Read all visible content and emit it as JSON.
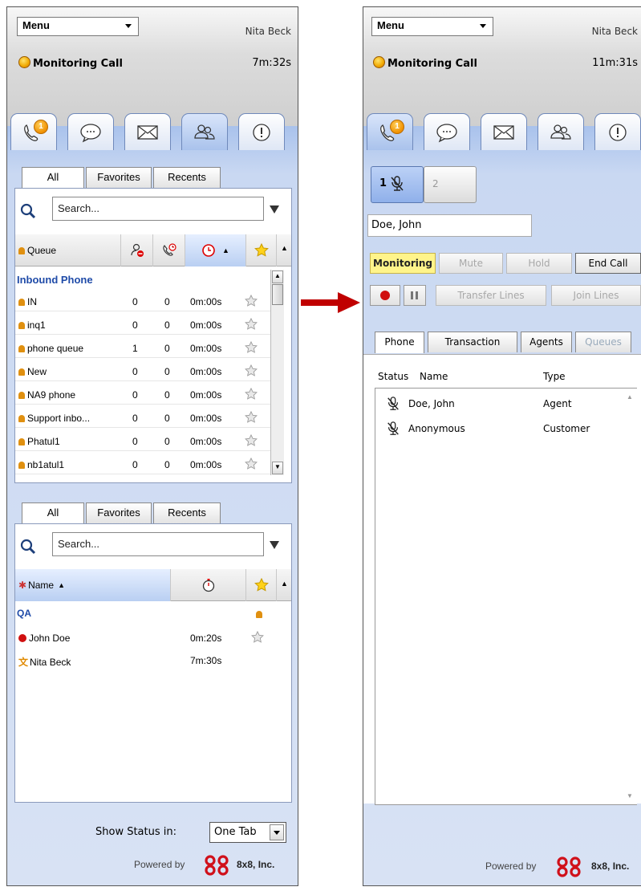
{
  "left": {
    "menu": "Menu",
    "user": "Nita Beck",
    "status": "Monitoring Call",
    "timer": "7m:32s",
    "badge": "1",
    "queue_tabs": [
      "All",
      "Favorites",
      "Recents"
    ],
    "queue_search": "Search...",
    "queue_header": "Queue",
    "queue_group": "Inbound Phone",
    "queues": [
      {
        "name": "IN",
        "a": "0",
        "b": "0",
        "t": "0m:00s"
      },
      {
        "name": "inq1",
        "a": "0",
        "b": "0",
        "t": "0m:00s"
      },
      {
        "name": "phone queue",
        "a": "1",
        "b": "0",
        "t": "0m:00s"
      },
      {
        "name": "New",
        "a": "0",
        "b": "0",
        "t": "0m:00s"
      },
      {
        "name": "NA9 phone",
        "a": "0",
        "b": "0",
        "t": "0m:00s"
      },
      {
        "name": "Support inbo...",
        "a": "0",
        "b": "0",
        "t": "0m:00s"
      },
      {
        "name": "Phatul1",
        "a": "0",
        "b": "0",
        "t": "0m:00s"
      },
      {
        "name": "nb1atul1",
        "a": "0",
        "b": "0",
        "t": "0m:00s"
      }
    ],
    "agent_tabs": [
      "All",
      "Favorites",
      "Recents"
    ],
    "agent_search": "Search...",
    "agent_header": "Name",
    "agent_group": "QA",
    "agents": [
      {
        "name": "John Doe",
        "t": "0m:20s",
        "status": "busy"
      },
      {
        "name": "Nita Beck",
        "t": "7m:30s",
        "status": "working"
      }
    ],
    "show_status_label": "Show Status in:",
    "show_status_value": "One Tab",
    "powered": "Powered by",
    "company": "8x8, Inc."
  },
  "right": {
    "menu": "Menu",
    "user": "Nita Beck",
    "status": "Monitoring Call",
    "timer": "11m:31s",
    "badge": "1",
    "line1": "1",
    "line2": "2",
    "caller": "Doe, John",
    "buttons": {
      "monitoring": "Monitoring",
      "mute": "Mute",
      "hold": "Hold",
      "end": "End Call",
      "transfer": "Transfer Lines",
      "join": "Join Lines"
    },
    "detail_tabs": [
      "Phone",
      "Transaction",
      "Agents",
      "Queues"
    ],
    "col_status": "Status",
    "col_name": "Name",
    "col_type": "Type",
    "participants": [
      {
        "name": "Doe, John",
        "type": "Agent"
      },
      {
        "name": "Anonymous",
        "type": "Customer"
      }
    ],
    "powered": "Powered by",
    "company": "8x8, Inc."
  },
  "colors": {
    "accent_blue": "#1f4ba8",
    "arrow_red": "#c00000",
    "monitor_yellow": "#fff48a"
  }
}
